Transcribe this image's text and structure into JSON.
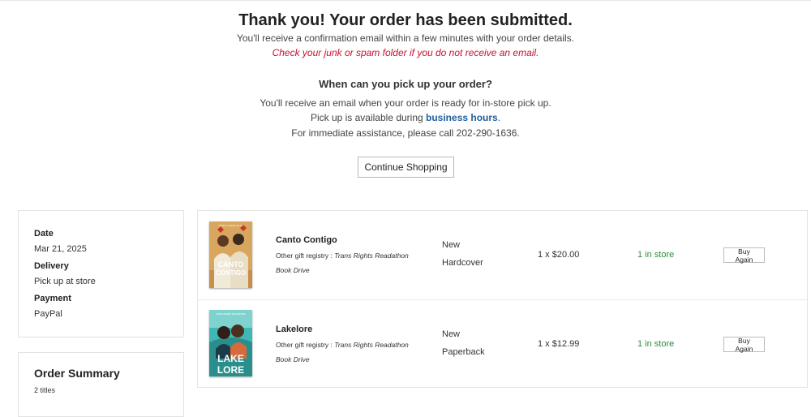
{
  "header": {
    "title": "Thank you! Your order has been submitted.",
    "confirmation": "You'll receive a confirmation email within a few minutes with your order details.",
    "junk_warning": "Check your junk or spam folder if you do not receive an email.",
    "pickup_heading": "When can you pick up your order?",
    "pickup_email": "You'll receive an email when your order is ready for in-store pick up.",
    "pickup_available_prefix": "Pick up is available during ",
    "business_hours_link": "business hours",
    "pickup_available_suffix": ".",
    "assistance": "For immediate assistance, please call 202-290-1636.",
    "continue_button": "Continue Shopping"
  },
  "order_info": {
    "date_label": "Date",
    "date_value": "Mar 21, 2025",
    "delivery_label": "Delivery",
    "delivery_value": "Pick up at store",
    "payment_label": "Payment",
    "payment_value": "PayPal"
  },
  "summary": {
    "title": "Order Summary",
    "count": "2 titles"
  },
  "items": [
    {
      "title": "Canto Contigo",
      "registry_prefix": "Other gift registry : ",
      "registry_name": "Trans Rights Readathon Book Drive",
      "condition": "New",
      "format": "Hardcover",
      "price": "1 x $20.00",
      "stock": "1 in store",
      "buy_again": "Buy Again",
      "cover_author": "JONNY GARZA VILLA",
      "cover_title_1": "CANTO",
      "cover_title_2": "CONTIGO"
    },
    {
      "title": "Lakelore",
      "registry_prefix": "Other gift registry : ",
      "registry_name": "Trans Rights Readathon Book Drive",
      "condition": "New",
      "format": "Paperback",
      "price": "1 x $12.99",
      "stock": "1 in store",
      "buy_again": "Buy Again",
      "cover_author": "ANNA-MARIE McLEMORE",
      "cover_title_1": "LAKE",
      "cover_title_2": "LORE"
    }
  ],
  "colors": {
    "warning": "#c8102e",
    "link": "#1f5e9c",
    "in_stock": "#2e8b3a"
  }
}
